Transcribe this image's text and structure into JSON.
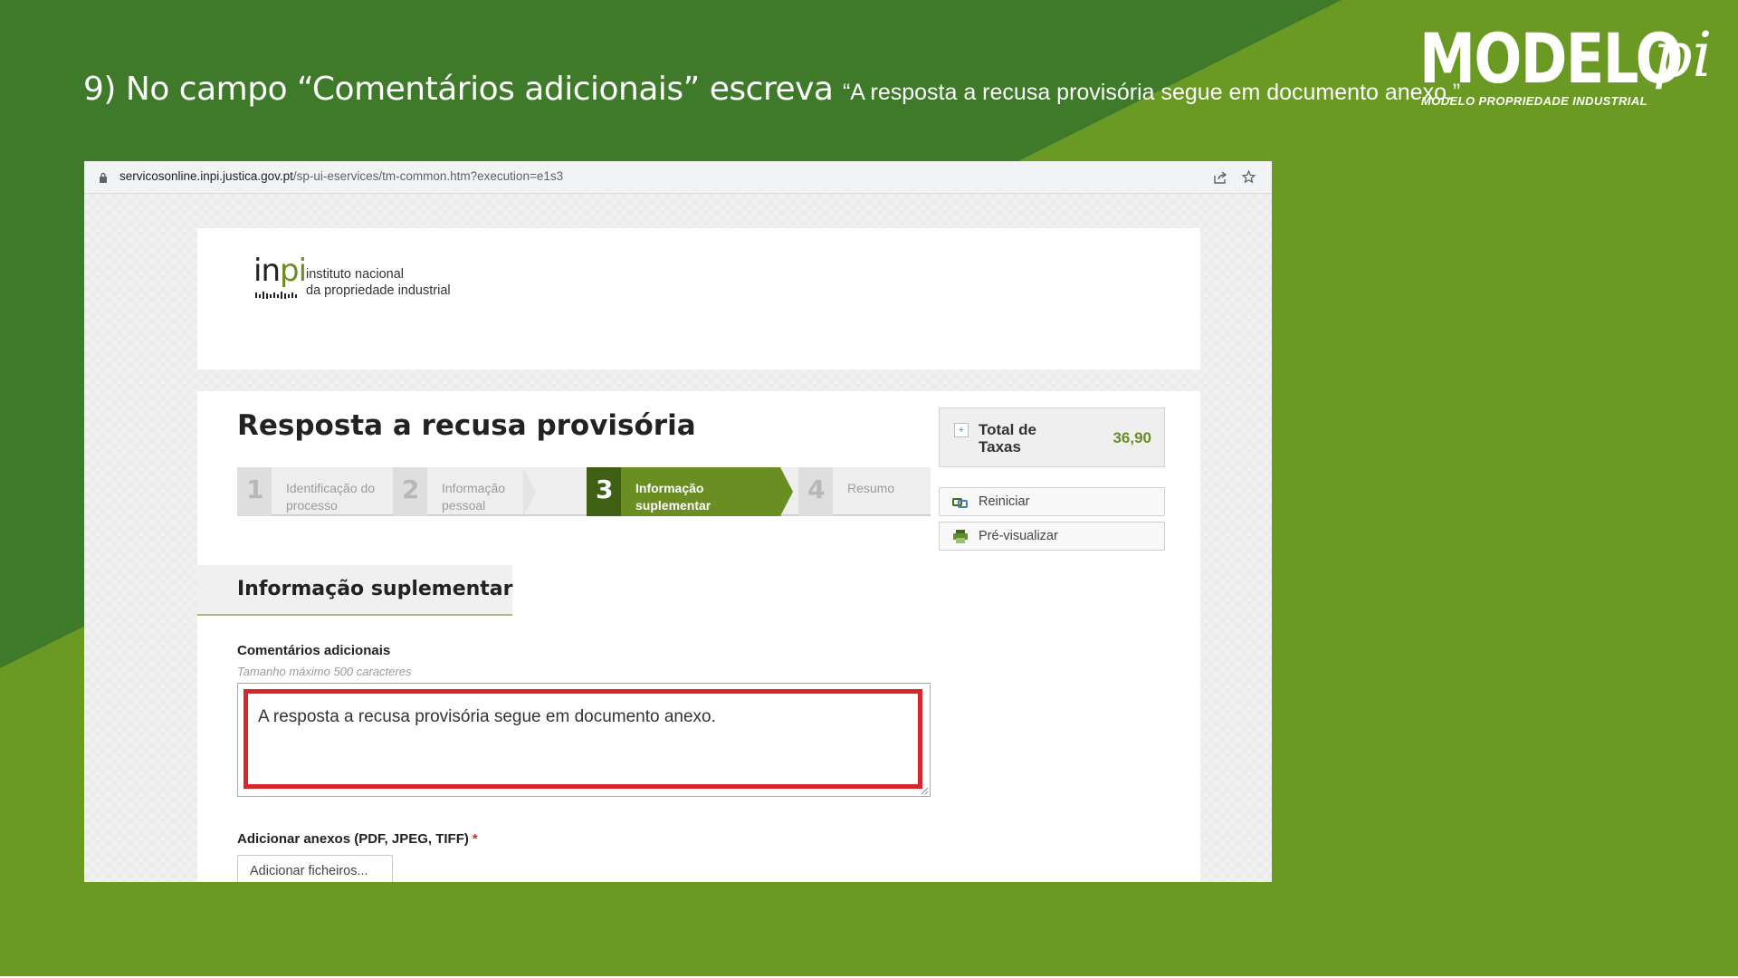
{
  "slide": {
    "instruction": "9) No campo “Comentários adicionais” escreva",
    "quote": "“A resposta a recusa provisória segue em documento anexo.”",
    "colors": {
      "dark_green": "#3e7a2a",
      "light_green": "#6a9a24",
      "highlight_red": "#d9262c"
    }
  },
  "brand": {
    "logo_word": "MODELO",
    "logo_pi": "pi",
    "tagline": "MODELO PROPRIEDADE INDUSTRIAL"
  },
  "browser": {
    "url_host": "servicosonline.inpi.justica.gov.pt",
    "url_path": "/sp-ui-eservices/tm-common.htm?execution=e1s3",
    "icons": [
      "lock-icon",
      "share-icon",
      "star-icon"
    ]
  },
  "site": {
    "logo_mark_in": "in",
    "logo_mark_pi": "pi",
    "logo_line1": "instituto nacional",
    "logo_line2": "da propriedade industrial"
  },
  "form": {
    "title": "Resposta a recusa provisória",
    "steps": [
      {
        "number": "1",
        "label_line1": "Identificação do",
        "label_line2": "processo",
        "active": false
      },
      {
        "number": "2",
        "label_line1": "Informação",
        "label_line2": "pessoal",
        "active": false
      },
      {
        "number": "3",
        "label_line1": "Informação",
        "label_line2": "suplementar",
        "active": true
      },
      {
        "number": "4",
        "label_line1": "Resumo",
        "label_line2": "",
        "active": false
      }
    ],
    "section_title": "Informação suplementar",
    "comments_label": "Comentários adicionais",
    "comments_hint": "Tamanho máximo 500 caracteres",
    "comments_value": "A resposta a recusa provisória segue em documento anexo.",
    "attachments_label": "Adicionar anexos (PDF, JPEG, TIFF)",
    "required_mark": "*",
    "attach_button": "Adicionar ficheiros..."
  },
  "sidebar": {
    "total_label_line1": "Total de",
    "total_label_line2": "Taxas",
    "total_value": "36,90",
    "expand_symbol": "+",
    "restart_button": "Reiniciar",
    "preview_button": "Pré-visualizar"
  }
}
